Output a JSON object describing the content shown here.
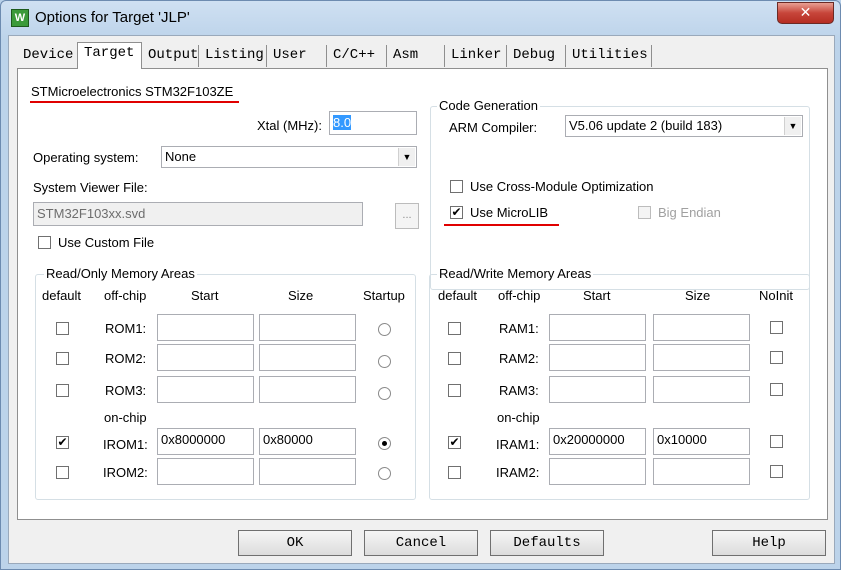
{
  "window": {
    "title": "Options for Target 'JLP'",
    "icon_text": "W",
    "close_glyph": "✕"
  },
  "tabs": [
    "Device",
    "Target",
    "Output",
    "Listing",
    "User",
    "C/C++",
    "Asm",
    "Linker",
    "Debug",
    "Utilities"
  ],
  "device": {
    "name": "STMicroelectronics STM32F103ZE"
  },
  "xtal": {
    "label": "Xtal (MHz):",
    "value": "8.0"
  },
  "os": {
    "label": "Operating system:",
    "value": "None"
  },
  "svd": {
    "label": "System Viewer File:",
    "value": "STM32F103xx.svd",
    "browse": "..."
  },
  "custom_file": {
    "label": "Use Custom File",
    "checked": false
  },
  "codegen": {
    "title": "Code Generation",
    "compiler_label": "ARM Compiler:",
    "compiler_value": "V5.06 update 2 (build 183)",
    "cross_module": {
      "label": "Use Cross-Module Optimization",
      "checked": false
    },
    "microlib": {
      "label": "Use MicroLIB",
      "checked": true
    },
    "big_endian": {
      "label": "Big Endian",
      "checked": false
    }
  },
  "rom": {
    "title": "Read/Only Memory Areas",
    "headers": {
      "default": "default",
      "offchip": "off-chip",
      "start": "Start",
      "size": "Size",
      "extra": "Startup"
    },
    "onchip_label": "on-chip",
    "rows": [
      {
        "name": "ROM1:",
        "default": false,
        "start": "",
        "size": "",
        "startup": false
      },
      {
        "name": "ROM2:",
        "default": false,
        "start": "",
        "size": "",
        "startup": false
      },
      {
        "name": "ROM3:",
        "default": false,
        "start": "",
        "size": "",
        "startup": false
      },
      {
        "name": "IROM1:",
        "default": true,
        "start": "0x8000000",
        "size": "0x80000",
        "startup": true
      },
      {
        "name": "IROM2:",
        "default": false,
        "start": "",
        "size": "",
        "startup": false
      }
    ]
  },
  "ram": {
    "title": "Read/Write Memory Areas",
    "headers": {
      "default": "default",
      "offchip": "off-chip",
      "start": "Start",
      "size": "Size",
      "extra": "NoInit"
    },
    "onchip_label": "on-chip",
    "rows": [
      {
        "name": "RAM1:",
        "default": false,
        "start": "",
        "size": "",
        "noinit": false
      },
      {
        "name": "RAM2:",
        "default": false,
        "start": "",
        "size": "",
        "noinit": false
      },
      {
        "name": "RAM3:",
        "default": false,
        "start": "",
        "size": "",
        "noinit": false
      },
      {
        "name": "IRAM1:",
        "default": true,
        "start": "0x20000000",
        "size": "0x10000",
        "noinit": false
      },
      {
        "name": "IRAM2:",
        "default": false,
        "start": "",
        "size": "",
        "noinit": false
      }
    ]
  },
  "buttons": {
    "ok": "OK",
    "cancel": "Cancel",
    "defaults": "Defaults",
    "help": "Help"
  },
  "colors": {
    "annotation_underline": "#e00000",
    "selection": "#3399ff"
  }
}
